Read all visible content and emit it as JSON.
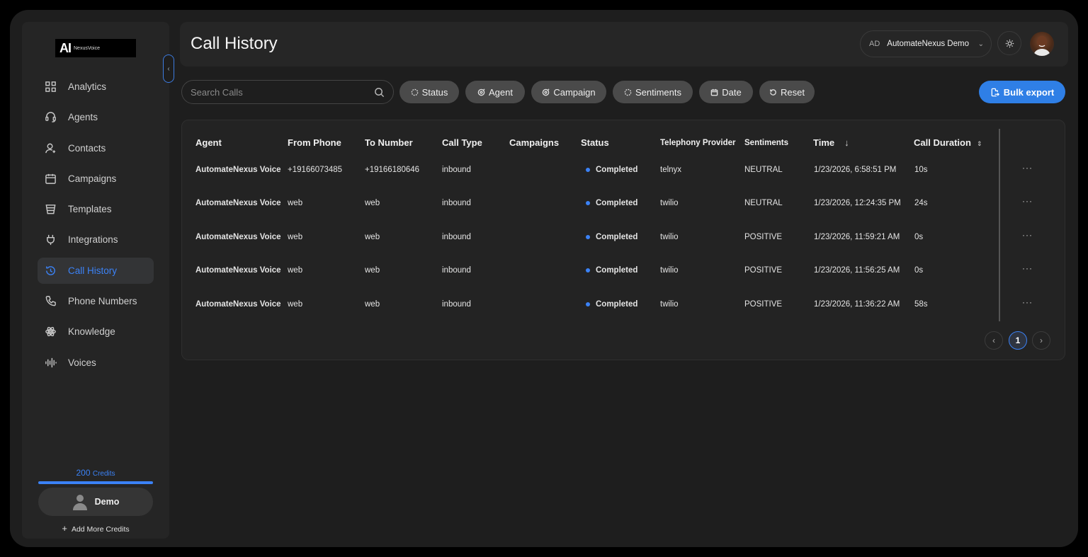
{
  "logo": {
    "mark": "AI",
    "text": "NexusVoice"
  },
  "sidebar": {
    "items": [
      {
        "label": "Analytics",
        "icon": "grid-icon",
        "active": false
      },
      {
        "label": "Agents",
        "icon": "headset-icon",
        "active": false
      },
      {
        "label": "Contacts",
        "icon": "contact-icon",
        "active": false
      },
      {
        "label": "Campaigns",
        "icon": "calendar-icon",
        "active": false
      },
      {
        "label": "Templates",
        "icon": "template-icon",
        "active": false
      },
      {
        "label": "Integrations",
        "icon": "plug-icon",
        "active": false
      },
      {
        "label": "Call History",
        "icon": "history-icon",
        "active": true
      },
      {
        "label": "Phone Numbers",
        "icon": "phone-icon",
        "active": false
      },
      {
        "label": "Knowledge",
        "icon": "atom-icon",
        "active": false
      },
      {
        "label": "Voices",
        "icon": "waveform-icon",
        "active": false
      }
    ],
    "credits_value": "200",
    "credits_unit": "Credits",
    "user_name": "Demo",
    "add_credits": "Add More Credits"
  },
  "header": {
    "title": "Call History",
    "org_initials": "AD",
    "org_name": "AutomateNexus Demo"
  },
  "toolbar": {
    "search_placeholder": "Search Calls",
    "filters": [
      "Status",
      "Agent",
      "Campaign",
      "Sentiments",
      "Date",
      "Reset"
    ],
    "bulk_export": "Bulk export"
  },
  "table": {
    "columns": [
      "Agent",
      "From Phone",
      "To Number",
      "Call Type",
      "Campaigns",
      "Status",
      "Telephony Provider",
      "Sentiments",
      "Time",
      "Call Duration"
    ],
    "rows": [
      {
        "agent": "AutomateNexus Voice",
        "from": "+19166073485",
        "to": "+19166180646",
        "type": "inbound",
        "campaign": "",
        "status": "Completed",
        "provider": "telnyx",
        "sentiment": "NEUTRAL",
        "time": "1/23/2026, 6:58:51 PM",
        "duration": "10s"
      },
      {
        "agent": "AutomateNexus Voice",
        "from": "web",
        "to": "web",
        "type": "inbound",
        "campaign": "",
        "status": "Completed",
        "provider": "twilio",
        "sentiment": "NEUTRAL",
        "time": "1/23/2026, 12:24:35 PM",
        "duration": "24s"
      },
      {
        "agent": "AutomateNexus Voice",
        "from": "web",
        "to": "web",
        "type": "inbound",
        "campaign": "",
        "status": "Completed",
        "provider": "twilio",
        "sentiment": "POSITIVE",
        "time": "1/23/2026, 11:59:21 AM",
        "duration": "0s"
      },
      {
        "agent": "AutomateNexus Voice",
        "from": "web",
        "to": "web",
        "type": "inbound",
        "campaign": "",
        "status": "Completed",
        "provider": "twilio",
        "sentiment": "POSITIVE",
        "time": "1/23/2026, 11:56:25 AM",
        "duration": "0s"
      },
      {
        "agent": "AutomateNexus Voice",
        "from": "web",
        "to": "web",
        "type": "inbound",
        "campaign": "",
        "status": "Completed",
        "provider": "twilio",
        "sentiment": "POSITIVE",
        "time": "1/23/2026, 11:36:22 AM",
        "duration": "58s"
      }
    ],
    "current_page": "1"
  },
  "colors": {
    "accent": "#3b82f6",
    "background": "#1e1e1e",
    "panel": "#262626"
  }
}
